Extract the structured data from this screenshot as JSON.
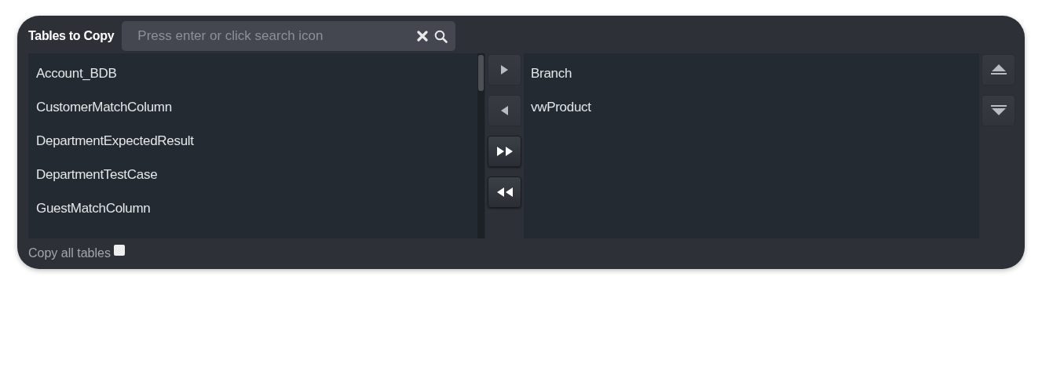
{
  "title": "Tables to Copy",
  "search": {
    "placeholder": "Press enter or click search icon"
  },
  "available": [
    {
      "label": "Account_BDB"
    },
    {
      "label": "CustomerMatchColumn"
    },
    {
      "label": "DepartmentExpectedResult"
    },
    {
      "label": "DepartmentTestCase"
    },
    {
      "label": "GuestMatchColumn"
    }
  ],
  "move_buttons": [
    {
      "kind": "right",
      "disabled": true
    },
    {
      "kind": "left",
      "disabled": true
    },
    {
      "kind": "all-right",
      "disabled": false
    },
    {
      "kind": "all-left",
      "disabled": false
    }
  ],
  "selected_tables": [
    {
      "label": "Branch"
    },
    {
      "label": "vwProduct"
    }
  ],
  "order_buttons": [
    {
      "kind": "up",
      "disabled": true
    },
    {
      "kind": "down",
      "disabled": true
    }
  ],
  "copy_all": {
    "label": "Copy all tables",
    "checked": false
  }
}
